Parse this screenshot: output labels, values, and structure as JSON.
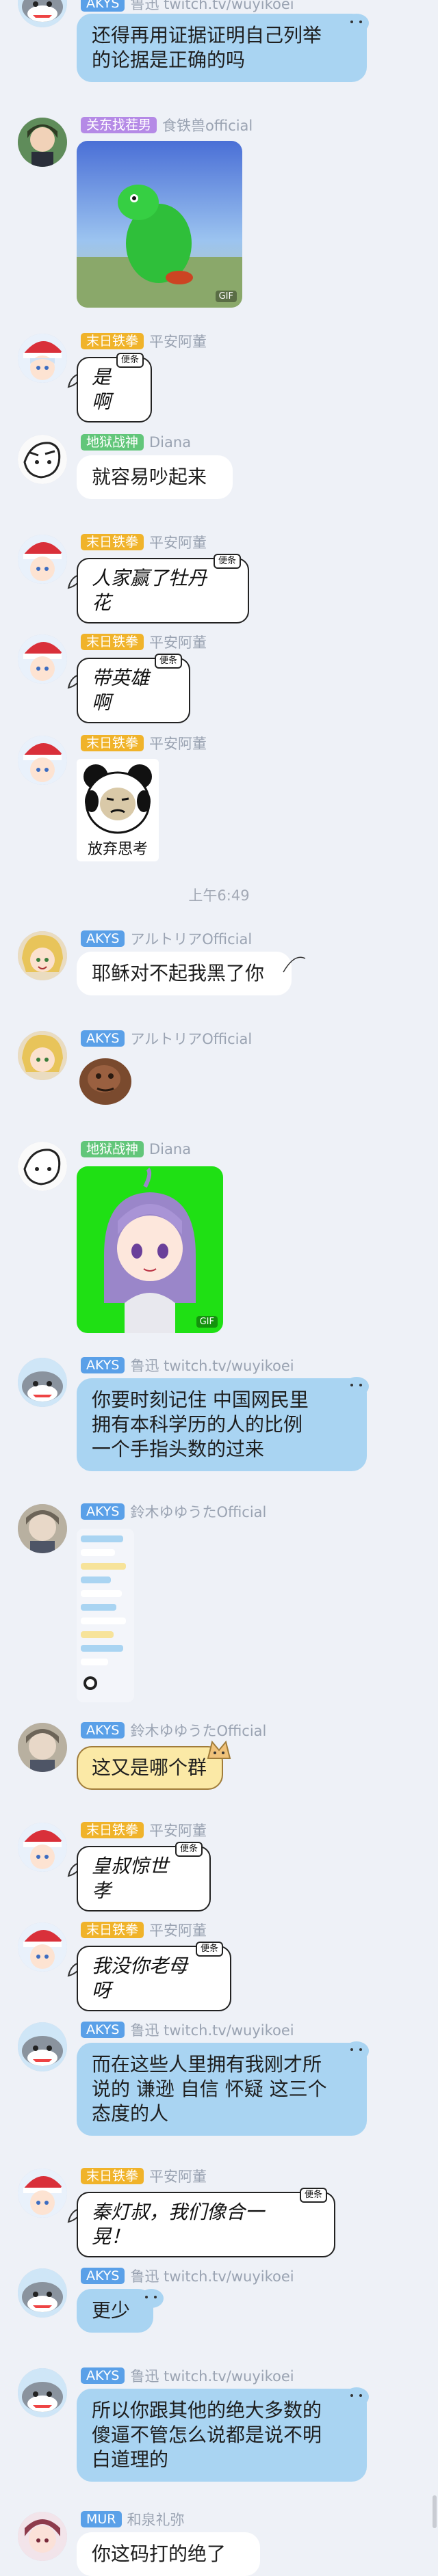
{
  "messages": [
    {
      "badge": "AKYS",
      "badge_color": "#5aa0e8",
      "nick": "鲁迅 twitch.tv/wuyikoei",
      "text": "还得再用证据证明自己列举\n的论据是正确的吗",
      "style": "blue"
    },
    {
      "badge": "关东找茬男",
      "badge_color": "#b58ae6",
      "nick": "食铁兽official",
      "media": "gif",
      "gif_label": "GIF"
    },
    {
      "badge": "末日铁拳",
      "badge_color": "#f0b32a",
      "nick": "平安阿董",
      "text": "是啊",
      "style": "hand",
      "tag": "便条"
    },
    {
      "badge": "地狱战神",
      "badge_color": "#62c67a",
      "nick": "Diana",
      "text": "就容易吵起来",
      "style": "white"
    },
    {
      "badge": "末日铁拳",
      "badge_color": "#f0b32a",
      "nick": "平安阿董",
      "text": "人家赢了牡丹花",
      "style": "hand",
      "tag": "便条"
    },
    {
      "badge": "末日铁拳",
      "badge_color": "#f0b32a",
      "nick": "平安阿董",
      "text": "带英雄啊",
      "style": "hand",
      "tag": "便条"
    },
    {
      "badge": "末日铁拳",
      "badge_color": "#f0b32a",
      "nick": "平安阿董",
      "media": "sticker",
      "caption": "放弃思考"
    },
    {
      "badge": "AKYS",
      "badge_color": "#5aa0e8",
      "nick": "アルトリアOfficial",
      "text": "耶稣对不起我黑了你",
      "style": "white"
    },
    {
      "badge": "AKYS",
      "badge_color": "#5aa0e8",
      "nick": "アルトリアOfficial",
      "media": "face"
    },
    {
      "badge": "地狱战神",
      "badge_color": "#62c67a",
      "nick": "Diana",
      "media": "vtuber",
      "gif_label": "GIF"
    },
    {
      "badge": "AKYS",
      "badge_color": "#5aa0e8",
      "nick": "鲁迅 twitch.tv/wuyikoei",
      "text": "你要时刻记住 中国网民里\n拥有本科学历的人的比例\n一个手指头数的过来",
      "style": "blue"
    },
    {
      "badge": "AKYS",
      "badge_color": "#5aa0e8",
      "nick": "鈴木ゆゆうたOfficial",
      "media": "screenshot"
    },
    {
      "badge": "AKYS",
      "badge_color": "#5aa0e8",
      "nick": "鈴木ゆゆうたOfficial",
      "text": "这又是哪个群",
      "style": "yellow"
    },
    {
      "badge": "末日铁拳",
      "badge_color": "#f0b32a",
      "nick": "平安阿董",
      "text": "皇叔惊世孝",
      "style": "hand",
      "tag": "便条"
    },
    {
      "badge": "末日铁拳",
      "badge_color": "#f0b32a",
      "nick": "平安阿董",
      "text": "我没你老母呀",
      "style": "hand",
      "tag": "便条"
    },
    {
      "badge": "AKYS",
      "badge_color": "#5aa0e8",
      "nick": "鲁迅 twitch.tv/wuyikoei",
      "text": "而在这些人里拥有我刚才所\n说的 谦逊 自信 怀疑 这三个\n态度的人",
      "style": "blue"
    },
    {
      "badge": "末日铁拳",
      "badge_color": "#f0b32a",
      "nick": "平安阿董",
      "text": "秦灯叔，我们像合一晃！",
      "style": "hand",
      "tag": "便条"
    },
    {
      "badge": "AKYS",
      "badge_color": "#5aa0e8",
      "nick": "鲁迅 twitch.tv/wuyikoei",
      "text": "更少",
      "style": "blue"
    },
    {
      "badge": "AKYS",
      "badge_color": "#5aa0e8",
      "nick": "鲁迅 twitch.tv/wuyikoei",
      "text": "所以你跟其他的绝大多数的\n傻逼不管怎么说都是说不明\n白道理的",
      "style": "blue"
    },
    {
      "badge": "MUR",
      "badge_color": "#5aa0e8",
      "nick": "和泉礼弥",
      "text": "你这码打的绝了",
      "style": "white"
    }
  ],
  "time_divider": "上午6:49"
}
